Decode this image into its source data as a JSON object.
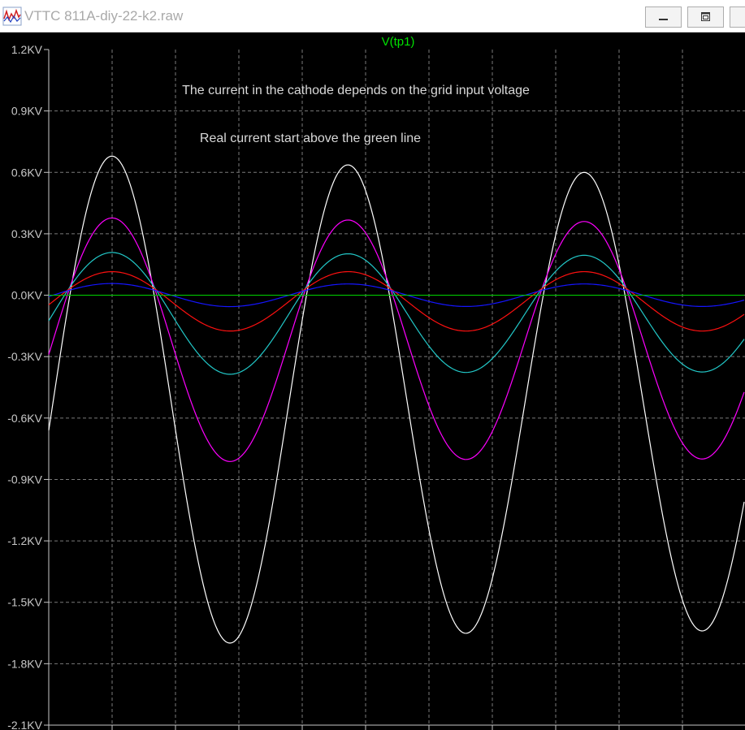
{
  "window": {
    "title": "VTTC 811A-diy-22-k2.raw",
    "app_icon": "waveform-viewer-icon",
    "buttons": {
      "minimize": "minimize-icon",
      "maximize": "maximize-icon",
      "close": "close-icon"
    }
  },
  "colors": {
    "background": "#000000",
    "axis": "#c8c8c8",
    "grid": "#7a7a7a",
    "trace_label": "#00e000",
    "annotation": "#d8d8d8"
  },
  "chart_data": {
    "type": "line",
    "title": "V(tp1)",
    "xlabel": "",
    "ylabel": "",
    "ylim": [
      -2.1,
      1.2
    ],
    "y_unit": "KV",
    "yticks": [
      "1.2KV",
      "0.9KV",
      "0.6KV",
      "0.3KV",
      "0.0KV",
      "-0.3KV",
      "-0.6KV",
      "-0.9KV",
      "-1.2KV",
      "-1.5KV",
      "-1.8KV",
      "-2.1KV"
    ],
    "grid": true,
    "annotations": [
      "The current in the cathode depends on the grid input voltage",
      "Real current start above the green line"
    ],
    "cycles_visible": 2.95,
    "series": [
      {
        "color": "#ffffff",
        "dc_offset": -0.52,
        "amplitude": [
          1.21,
          1.17,
          1.12
        ]
      },
      {
        "color": "#ff00ff",
        "dc_offset": -0.22,
        "amplitude": [
          0.6,
          0.59,
          0.58
        ]
      },
      {
        "color": "#22c8c8",
        "dc_offset": -0.09,
        "amplitude": [
          0.3,
          0.295,
          0.285
        ]
      },
      {
        "color": "#ff1010",
        "dc_offset": -0.03,
        "amplitude": [
          0.145,
          0.145,
          0.145
        ]
      },
      {
        "color": "#1515ff",
        "dc_offset": 0.0,
        "amplitude": [
          0.058,
          0.055,
          0.055
        ]
      },
      {
        "color": "#00c800",
        "dc_offset": 0.0,
        "amplitude": [
          0,
          0,
          0
        ]
      }
    ]
  }
}
